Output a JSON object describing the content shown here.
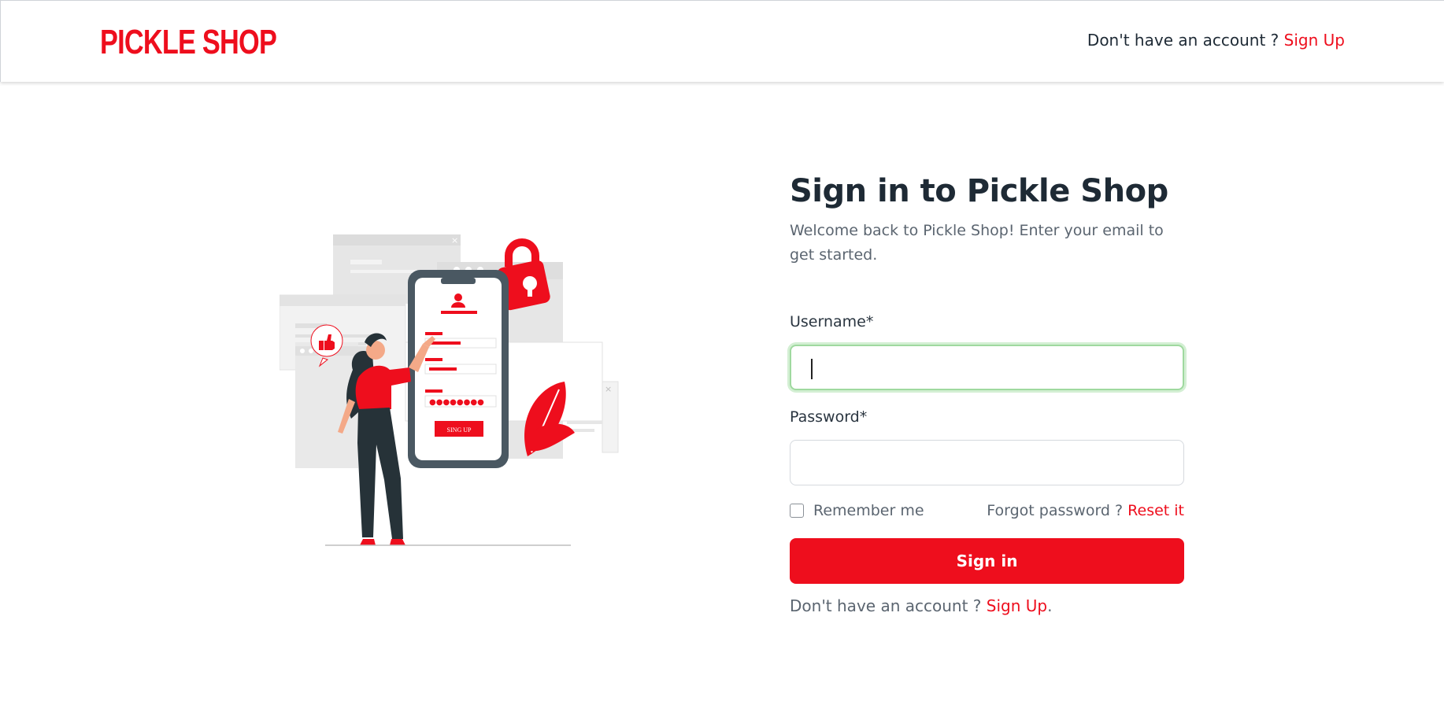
{
  "brand": {
    "logo_text": "PICKLE SHOP",
    "accent_color": "#ee0e1d"
  },
  "header": {
    "prompt": "Don't have an account ?",
    "signup_link": "Sign Up"
  },
  "illustration": {
    "phone_button_label": "SING UP",
    "icons": [
      "user-icon",
      "lock-icon",
      "thumbs-up-icon",
      "close-icon"
    ]
  },
  "form": {
    "title": "Sign in to Pickle Shop",
    "subtitle": "Welcome back to Pickle Shop! Enter your email to get started.",
    "username_label": "Username*",
    "username_value": "",
    "password_label": "Password*",
    "password_value": "",
    "remember_label": "Remember me",
    "forgot_prompt": "Forgot password ?",
    "reset_link": "Reset it",
    "submit_label": "Sign in",
    "bottom_prompt": "Don't have an account ?",
    "bottom_link": "Sign Up",
    "bottom_period": "."
  }
}
